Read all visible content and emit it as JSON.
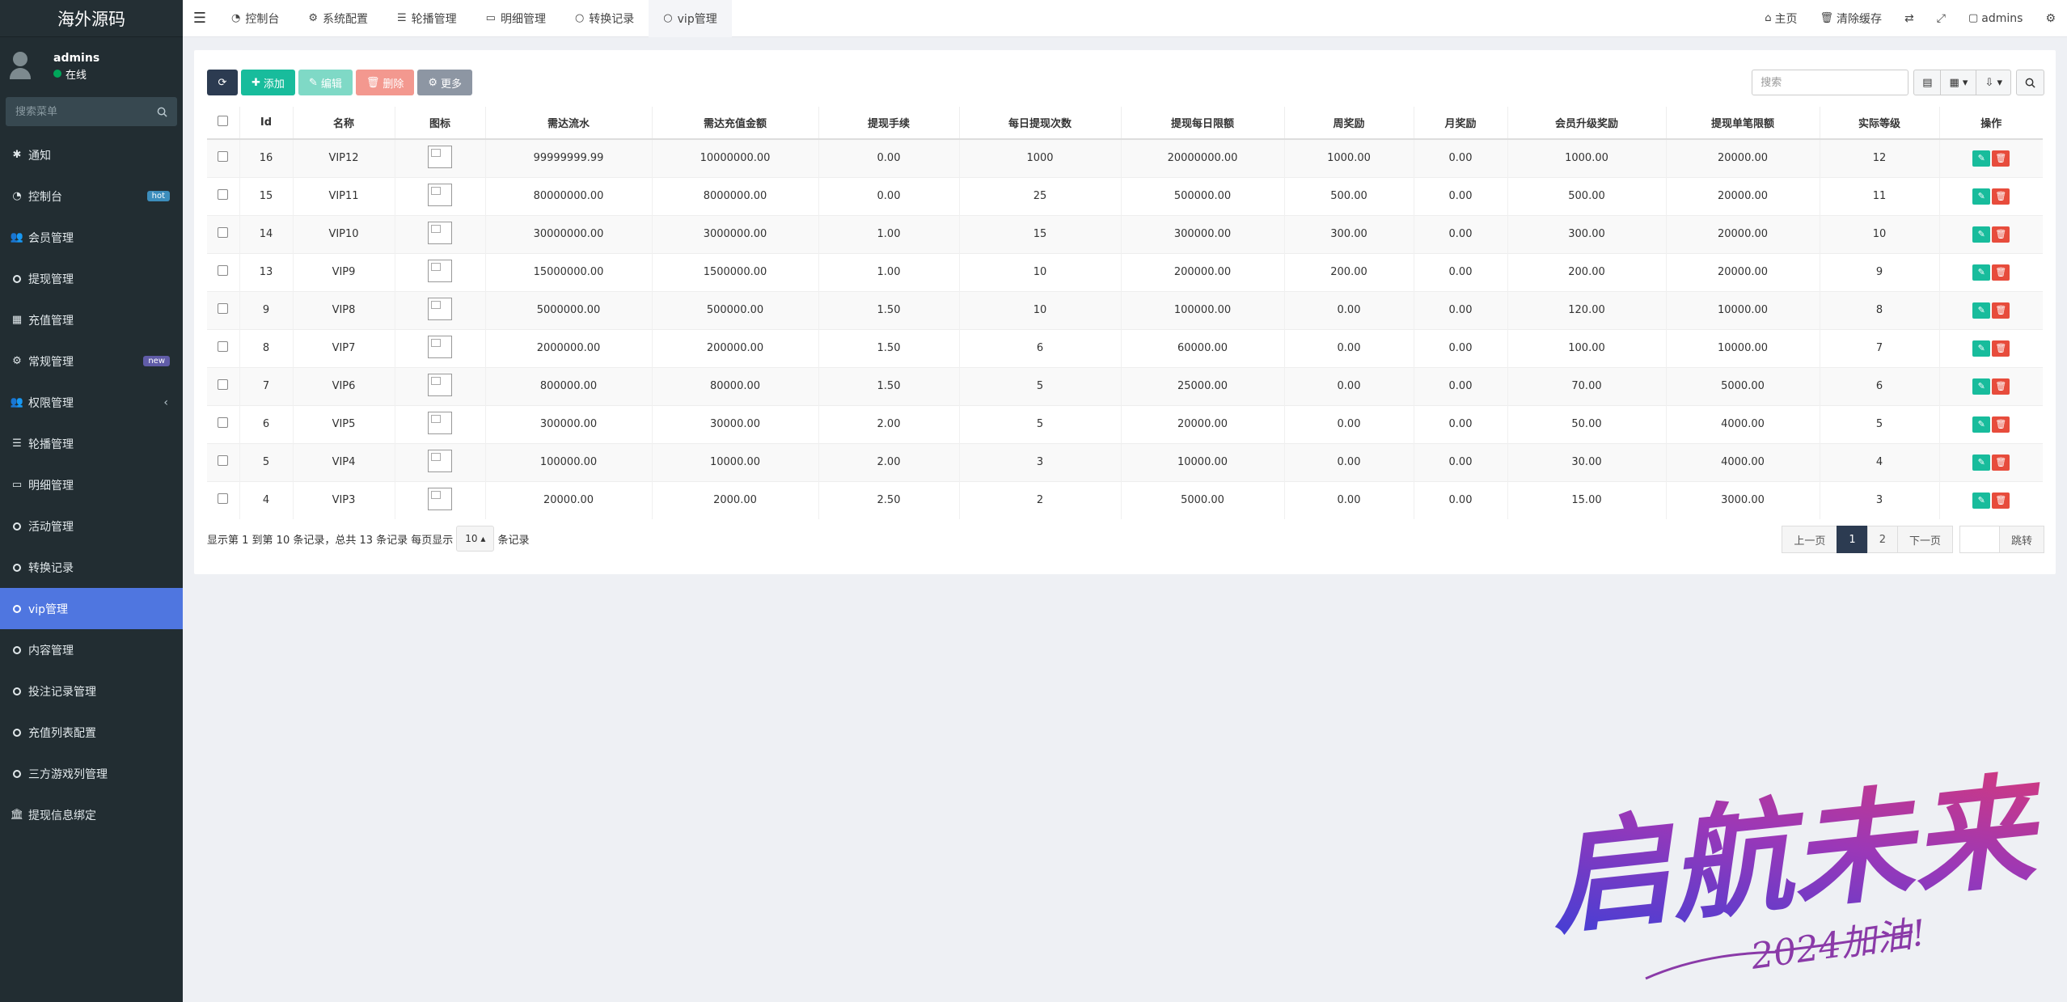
{
  "sidebar": {
    "brand": "海外源码",
    "user_name": "admins",
    "user_status": "在线",
    "search_placeholder": "搜索菜单",
    "items": [
      {
        "label": "通知",
        "icon": "gear-icon"
      },
      {
        "label": "控制台",
        "icon": "dashboard-icon",
        "badge": "hot"
      },
      {
        "label": "会员管理",
        "icon": "users-icon"
      },
      {
        "label": "提现管理",
        "icon": "circle-icon"
      },
      {
        "label": "充值管理",
        "icon": "grid-icon"
      },
      {
        "label": "常规管理",
        "icon": "cogs-icon",
        "badge": "new"
      },
      {
        "label": "权限管理",
        "icon": "group-icon"
      },
      {
        "label": "轮播管理",
        "icon": "list-icon"
      },
      {
        "label": "明细管理",
        "icon": "calendar-icon"
      },
      {
        "label": "活动管理",
        "icon": "circle-icon"
      },
      {
        "label": "转换记录",
        "icon": "circle-icon"
      },
      {
        "label": "vip管理",
        "icon": "circle-icon"
      },
      {
        "label": "内容管理",
        "icon": "circle-icon"
      },
      {
        "label": "投注记录管理",
        "icon": "circle-icon"
      },
      {
        "label": "充值列表配置",
        "icon": "circle-icon"
      },
      {
        "label": "三方游戏列管理",
        "icon": "circle-icon"
      },
      {
        "label": "提现信息绑定",
        "icon": "bank-icon"
      }
    ]
  },
  "topbar": {
    "tabs": [
      "控制台",
      "系统配置",
      "轮播管理",
      "明细管理",
      "转换记录",
      "vip管理"
    ],
    "home": "主页",
    "clear_cache": "清除缓存",
    "user": "admins"
  },
  "toolbar": {
    "add": "添加",
    "edit": "编辑",
    "delete": "删除",
    "more": "更多",
    "search_placeholder": "搜索"
  },
  "table": {
    "headers": [
      "Id",
      "名称",
      "图标",
      "需达流水",
      "需达充值金额",
      "提现手续",
      "每日提现次数",
      "提现每日限额",
      "周奖励",
      "月奖励",
      "会员升级奖励",
      "提现单笔限额",
      "实际等级",
      "操作"
    ],
    "rows": [
      [
        "16",
        "VIP12",
        "99999999.99",
        "10000000.00",
        "0.00",
        "1000",
        "20000000.00",
        "1000.00",
        "0.00",
        "1000.00",
        "20000.00",
        "12"
      ],
      [
        "15",
        "VIP11",
        "80000000.00",
        "8000000.00",
        "0.00",
        "25",
        "500000.00",
        "500.00",
        "0.00",
        "500.00",
        "20000.00",
        "11"
      ],
      [
        "14",
        "VIP10",
        "30000000.00",
        "3000000.00",
        "1.00",
        "15",
        "300000.00",
        "300.00",
        "0.00",
        "300.00",
        "20000.00",
        "10"
      ],
      [
        "13",
        "VIP9",
        "15000000.00",
        "1500000.00",
        "1.00",
        "10",
        "200000.00",
        "200.00",
        "0.00",
        "200.00",
        "20000.00",
        "9"
      ],
      [
        "9",
        "VIP8",
        "5000000.00",
        "500000.00",
        "1.50",
        "10",
        "100000.00",
        "0.00",
        "0.00",
        "120.00",
        "10000.00",
        "8"
      ],
      [
        "8",
        "VIP7",
        "2000000.00",
        "200000.00",
        "1.50",
        "6",
        "60000.00",
        "0.00",
        "0.00",
        "100.00",
        "10000.00",
        "7"
      ],
      [
        "7",
        "VIP6",
        "800000.00",
        "80000.00",
        "1.50",
        "5",
        "25000.00",
        "0.00",
        "0.00",
        "70.00",
        "5000.00",
        "6"
      ],
      [
        "6",
        "VIP5",
        "300000.00",
        "30000.00",
        "2.00",
        "5",
        "20000.00",
        "0.00",
        "0.00",
        "50.00",
        "4000.00",
        "5"
      ],
      [
        "5",
        "VIP4",
        "100000.00",
        "10000.00",
        "2.00",
        "3",
        "10000.00",
        "0.00",
        "0.00",
        "30.00",
        "4000.00",
        "4"
      ],
      [
        "4",
        "VIP3",
        "20000.00",
        "2000.00",
        "2.50",
        "2",
        "5000.00",
        "0.00",
        "0.00",
        "15.00",
        "3000.00",
        "3"
      ]
    ]
  },
  "footer": {
    "info_prefix": "显示第 1 到第 10 条记录，总共 13 条记录 每页显示",
    "page_size": "10",
    "info_suffix": "条记录",
    "prev": "上一页",
    "pages": [
      "1",
      "2"
    ],
    "next": "下一页",
    "go": "跳转"
  },
  "watermark": {
    "main": "启航未来",
    "sub": "2024加油!"
  },
  "colors": {
    "sidebar_bg": "#222d32",
    "active": "#4f76e0",
    "primary": "#2c3b51",
    "success": "#18bc9c",
    "danger": "#e74c3c"
  }
}
